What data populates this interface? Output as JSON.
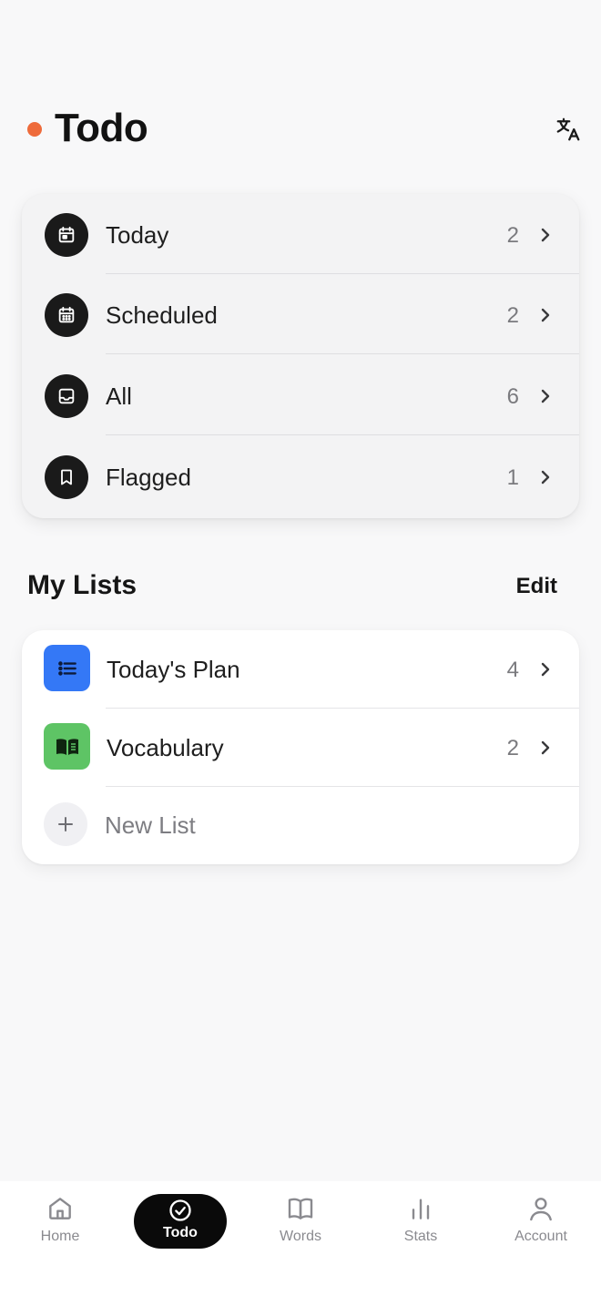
{
  "header": {
    "title": "Todo",
    "accent_color": "#ee6b3b",
    "translate_icon": "translate-icon"
  },
  "smart_lists": [
    {
      "label": "Today",
      "count": "2",
      "icon": "calendar-day-icon"
    },
    {
      "label": "Scheduled",
      "count": "2",
      "icon": "calendar-grid-icon"
    },
    {
      "label": "All",
      "count": "6",
      "icon": "inbox-icon"
    },
    {
      "label": "Flagged",
      "count": "1",
      "icon": "bookmark-icon"
    }
  ],
  "my_lists": {
    "title": "My Lists",
    "edit_label": "Edit",
    "items": [
      {
        "label": "Today's Plan",
        "count": "4",
        "icon": "list-icon",
        "color": "#3478f6"
      },
      {
        "label": "Vocabulary",
        "count": "2",
        "icon": "book-icon",
        "color": "#5ec465"
      }
    ],
    "new_list_label": "New List"
  },
  "bottom_nav": {
    "active": "Todo",
    "items": [
      {
        "label": "Home",
        "icon": "home-icon"
      },
      {
        "label": "Todo",
        "icon": "check-circle-icon"
      },
      {
        "label": "Words",
        "icon": "open-book-icon"
      },
      {
        "label": "Stats",
        "icon": "bar-chart-icon"
      },
      {
        "label": "Account",
        "icon": "person-icon"
      }
    ]
  }
}
